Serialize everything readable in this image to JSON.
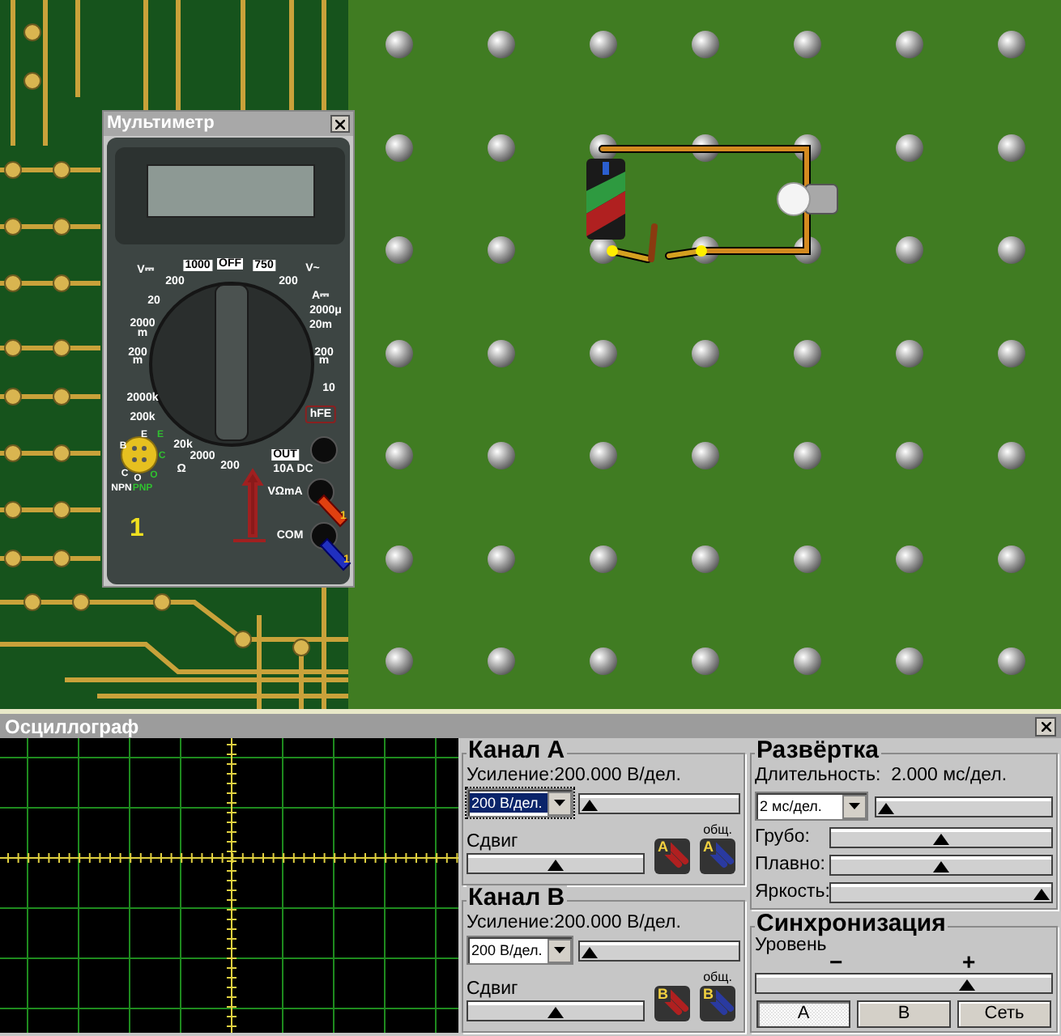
{
  "circuit": {
    "switch": {
      "closed": false
    }
  },
  "multimeter": {
    "title": "Мультиметр",
    "dial_labels": [
      {
        "text": "V⎓",
        "kind": "plain"
      },
      {
        "text": "1000",
        "kind": "boxed"
      },
      {
        "text": "OFF",
        "kind": "boxed"
      },
      {
        "text": "750",
        "kind": "boxed"
      },
      {
        "text": "V~",
        "kind": "plain"
      },
      {
        "text": "200",
        "kind": "plain"
      },
      {
        "text": "200",
        "kind": "plain"
      },
      {
        "text": "A⎓",
        "kind": "plain"
      },
      {
        "text": "20",
        "kind": "plain"
      },
      {
        "text": "2000μ",
        "kind": "plain"
      },
      {
        "text": "2000",
        "kind": "plain"
      },
      {
        "text": "m",
        "kind": "plain"
      },
      {
        "text": "20m",
        "kind": "plain"
      },
      {
        "text": "200",
        "kind": "plain"
      },
      {
        "text": "m",
        "kind": "plain"
      },
      {
        "text": "200",
        "kind": "plain"
      },
      {
        "text": "m",
        "kind": "plain"
      },
      {
        "text": "10",
        "kind": "plain"
      },
      {
        "text": "2000k",
        "kind": "plain"
      },
      {
        "text": "200k",
        "kind": "plain"
      },
      {
        "text": "hFE",
        "kind": "framed"
      },
      {
        "text": "20k",
        "kind": "plain"
      },
      {
        "text": "2000",
        "kind": "plain"
      },
      {
        "text": "Ω",
        "kind": "plain"
      },
      {
        "text": "200",
        "kind": "plain"
      },
      {
        "text": "OUT",
        "kind": "boxed"
      },
      {
        "text": "10A DC",
        "kind": "plain"
      },
      {
        "text": "VΩmA",
        "kind": "plain"
      },
      {
        "text": "COM",
        "kind": "plain"
      }
    ],
    "transistor_labels": [
      {
        "text": "B",
        "kind": "npn"
      },
      {
        "text": "E",
        "kind": "npn"
      },
      {
        "text": "E",
        "kind": "pnp"
      },
      {
        "text": "C",
        "kind": "pnp"
      },
      {
        "text": "C",
        "kind": "npn"
      },
      {
        "text": "O",
        "kind": "npn"
      },
      {
        "text": "O",
        "kind": "pnp"
      },
      {
        "text": "NPN",
        "kind": "npn"
      },
      {
        "text": "PNP",
        "kind": "pnp"
      }
    ],
    "mode_digit": "1",
    "probe_tags": [
      "1",
      "1"
    ]
  },
  "oscilloscope": {
    "title": "Осциллограф",
    "channels": [
      {
        "title": "Канал А",
        "gain": "Усиление:200.000 В/дел.",
        "dropdown": {
          "value": "200 В/дел.",
          "focused": true
        },
        "gain_slider": {
          "level": 0.0
        },
        "offset_label": "Сдвиг",
        "offset_slider": {
          "level": 0.5
        },
        "common_label": "общ.",
        "probe_letters": [
          "A",
          "A"
        ]
      },
      {
        "title": "Канал В",
        "gain": "Усиление:200.000 В/дел.",
        "dropdown": {
          "value": "200 В/дел.",
          "focused": false
        },
        "gain_slider": {
          "level": 0.0
        },
        "offset_label": "Сдвиг",
        "offset_slider": {
          "level": 0.5
        },
        "common_label": "общ.",
        "probe_letters": [
          "B",
          "B"
        ]
      }
    ],
    "sweep": {
      "title": "Развёртка",
      "duration": "Длительность:  2.000 мс/дел.",
      "dropdown": {
        "value": "2 мс/дел."
      },
      "slider": {
        "level": 0.0
      },
      "rows": [
        {
          "label": "Грубо:",
          "level": 0.5
        },
        {
          "label": "Плавно:",
          "level": 0.5
        },
        {
          "label": "Яркость:",
          "level": 1.0
        }
      ]
    },
    "sync": {
      "title": "Синхронизация",
      "level_label": "Уровень",
      "minus": "−",
      "plus": "+",
      "slider": {
        "level": 0.73
      },
      "buttons": [
        {
          "label": "А",
          "selected": true
        },
        {
          "label": "В",
          "selected": false
        },
        {
          "label": "Сеть",
          "selected": false
        }
      ]
    }
  }
}
